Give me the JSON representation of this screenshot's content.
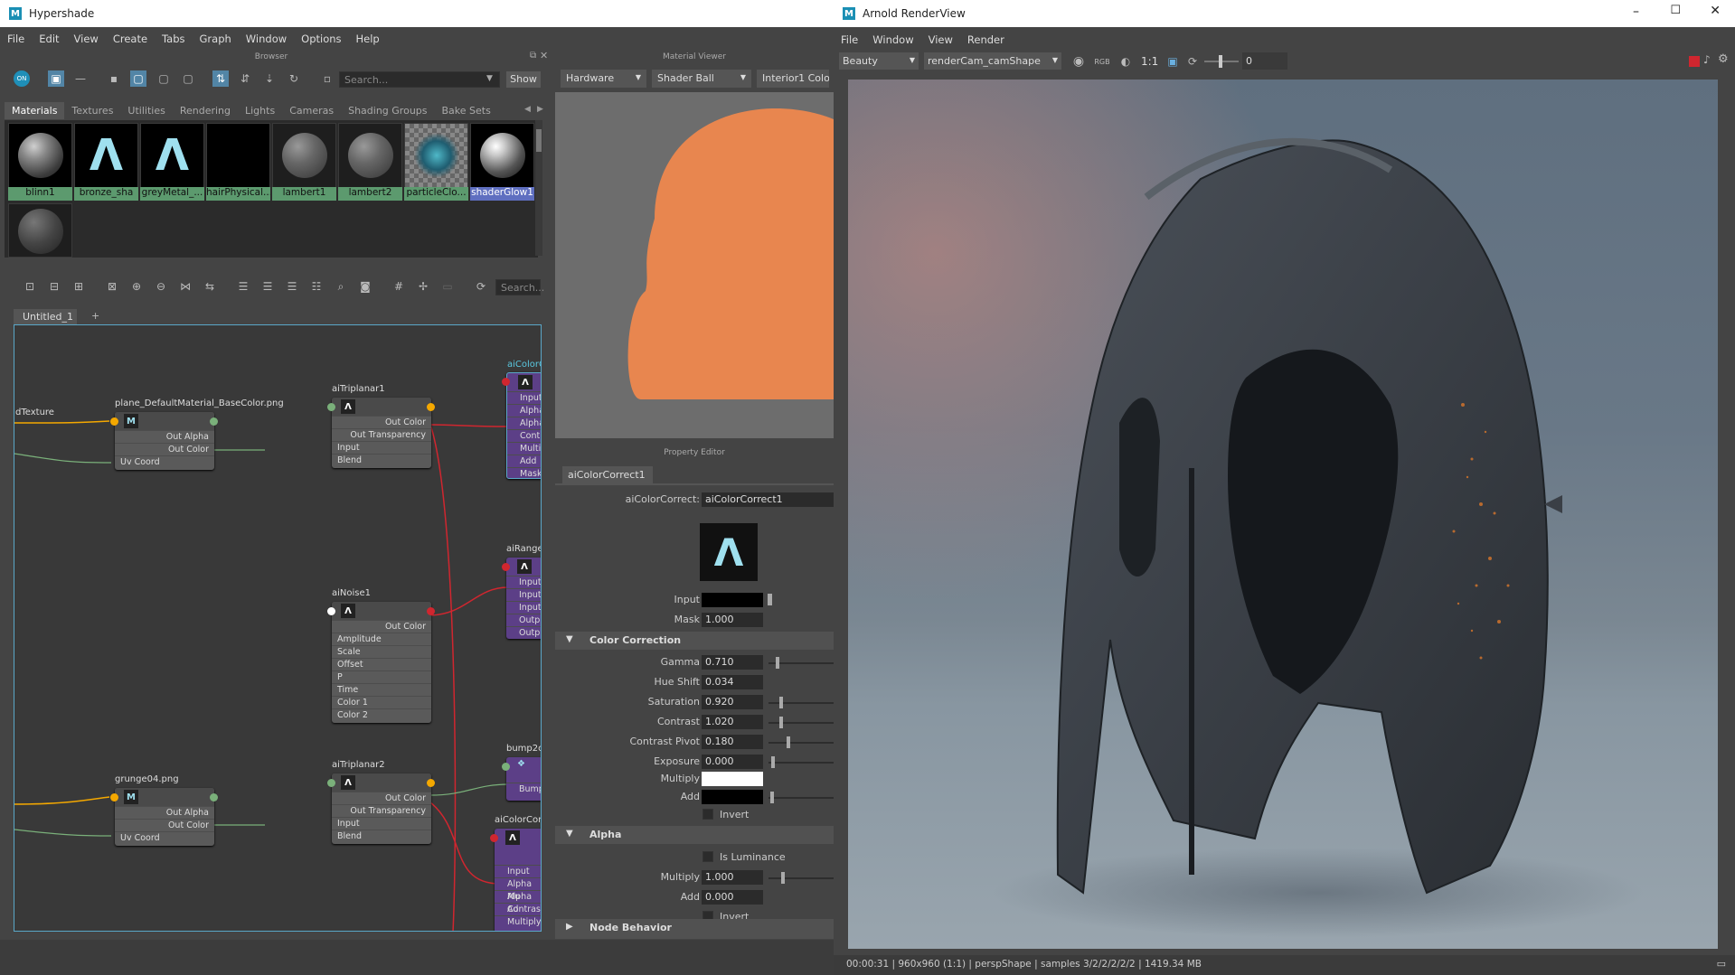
{
  "hypershade": {
    "title": "Hypershade",
    "menu": [
      "File",
      "Edit",
      "View",
      "Create",
      "Tabs",
      "Graph",
      "Window",
      "Options",
      "Help"
    ],
    "browser_header": "Browser",
    "material_viewer_header": "Material Viewer",
    "property_editor_header": "Property Editor",
    "browser_search_placeholder": "Search...",
    "show_label": "Show",
    "browser_tabs": [
      "Materials",
      "Textures",
      "Utilities",
      "Rendering",
      "Lights",
      "Cameras",
      "Shading Groups",
      "Bake Sets"
    ],
    "swatches": [
      "blinn1",
      "bronze_sha",
      "greyMetal_...",
      "hairPhysical...",
      "lambert1",
      "lambert2",
      "particleClo...",
      "shaderGlow1"
    ],
    "graph_search_placeholder": "Search...",
    "graph_tab": "Untitled_1",
    "graph_tab_add": "+",
    "viewer": {
      "renderer": "Hardware",
      "geometry": "Shader Ball",
      "environment": "Interior1 Colo"
    },
    "nodes": {
      "tex1": {
        "title": "plane_DefaultMaterial_BaseColor.png",
        "rows": [
          "Out Alpha",
          "Out Color",
          "Uv Coord"
        ]
      },
      "tex_left": "dTexture",
      "tri1": {
        "title": "aiTriplanar1",
        "rows": [
          "Out Color",
          "Out Transparency",
          "Input",
          "Blend"
        ]
      },
      "noise": {
        "title": "aiNoise1",
        "rows": [
          "Out Color",
          "Amplitude",
          "Scale",
          "Offset",
          "P",
          "Time",
          "Color 1",
          "Color 2"
        ]
      },
      "tex2": {
        "title": "grunge04.png",
        "rows": [
          "Out Alpha",
          "Out Color",
          "Uv Coord"
        ]
      },
      "tri2": {
        "title": "aiTriplanar2",
        "rows": [
          "Out Color",
          "Out Transparency",
          "Input",
          "Blend"
        ]
      },
      "cc_top": {
        "title": "aiColorC",
        "rows": [
          "Input",
          "Alpha",
          "Alpha",
          "Contr",
          "Multip",
          "Add",
          "Mask"
        ]
      },
      "range": {
        "title": "aiRange",
        "rows": [
          "Input",
          "Input",
          "Input",
          "Outpu",
          "Outpu"
        ]
      },
      "bump": {
        "title": "bump2c",
        "rows": [
          "Bump"
        ]
      },
      "cc_bot": {
        "title": "aiColorCor",
        "rows": [
          "Input",
          "Alpha Mu",
          "Alpha Ad",
          "Contrast",
          "Multiply"
        ]
      }
    },
    "property": {
      "tab": "aiColorCorrect1",
      "node_label": "aiColorCorrect:",
      "node_value": "aiColorCorrect1",
      "input_label": "Input",
      "mask_label": "Mask",
      "mask_value": "1.000",
      "sections": {
        "color_correction": "Color Correction",
        "alpha": "Alpha",
        "node_behavior": "Node Behavior"
      },
      "cc": [
        {
          "label": "Gamma",
          "value": "0.710",
          "fraction": 0.12
        },
        {
          "label": "Hue Shift",
          "value": "0.034",
          "fraction": null
        },
        {
          "label": "Saturation",
          "value": "0.920",
          "fraction": 0.17
        },
        {
          "label": "Contrast",
          "value": "1.020",
          "fraction": 0.17
        },
        {
          "label": "Contrast Pivot",
          "value": "0.180",
          "fraction": 0.3
        },
        {
          "label": "Exposure",
          "value": "0.000",
          "fraction": 0.05
        }
      ],
      "multiply_label": "Multiply",
      "add_label": "Add",
      "invert_label": "Invert",
      "is_luminance_label": "Is Luminance",
      "alpha_multiply_label": "Multiply",
      "alpha_multiply_value": "1.000",
      "alpha_add_label": "Add",
      "alpha_add_value": "0.000",
      "alpha_invert_label": "Invert"
    }
  },
  "renderview": {
    "title": "Arnold RenderView",
    "menu": [
      "File",
      "Window",
      "View",
      "Render"
    ],
    "aov": "Beauty",
    "camera": "renderCam_camShape",
    "ratio": "1:1",
    "exposure_value": "0",
    "status": "00:00:31 | 960x960 (1:1) | perspShape  | samples 3/2/2/2/2/2 | 1419.34 MB"
  },
  "colors": {
    "accent": "#5285a6",
    "node_port_red": "#d0262f",
    "node_port_yellow": "#f4a800",
    "viewer_ball": "#e8864f"
  }
}
